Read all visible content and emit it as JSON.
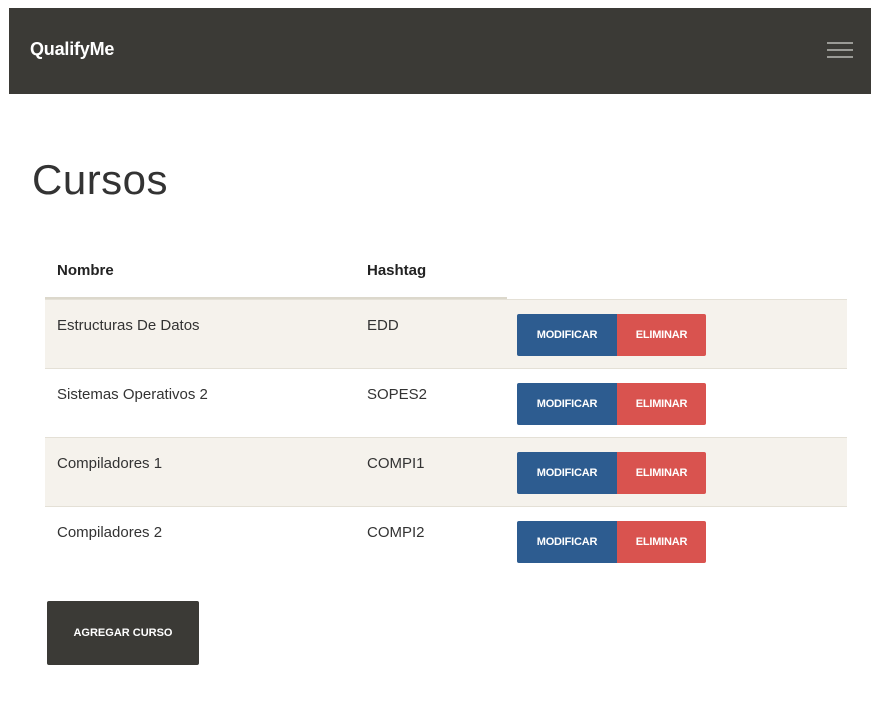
{
  "navbar": {
    "brand": "QualifyMe",
    "menu_icon": "hamburger-menu-icon"
  },
  "page": {
    "title": "Cursos"
  },
  "table": {
    "columns": [
      "Nombre",
      "Hashtag"
    ],
    "rows": [
      {
        "name": "Estructuras De Datos",
        "hashtag": "EDD",
        "modify_label": "MODIFICAR",
        "delete_label": "ELIMINAR"
      },
      {
        "name": "Sistemas Operativos 2",
        "hashtag": "SOPES2",
        "modify_label": "MODIFICAR",
        "delete_label": "ELIMINAR"
      },
      {
        "name": "Compiladores 1",
        "hashtag": "COMPI1",
        "modify_label": "MODIFICAR",
        "delete_label": "ELIMINAR"
      },
      {
        "name": "Compiladores 2",
        "hashtag": "COMPI2",
        "modify_label": "MODIFICAR",
        "delete_label": "ELIMINAR"
      }
    ]
  },
  "actions": {
    "add_label": "AGREGAR CURSO"
  },
  "colors": {
    "navbar": "#3b3a36",
    "modify_button": "#2d5c90",
    "delete_button": "#d9534f",
    "stripe": "#f5f2ec"
  }
}
